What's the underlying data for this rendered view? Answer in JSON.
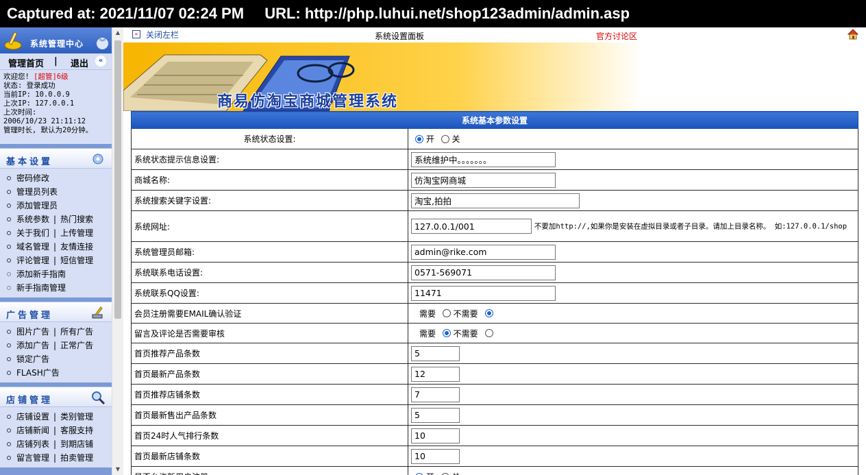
{
  "capture": {
    "captured": "Captured at: 2021/11/07 02:24 PM",
    "url": "URL: http://php.luhui.net/shop123admin/admin.asp"
  },
  "left": {
    "title": "系统管理中心",
    "nav_home": "管理首页",
    "nav_sep": "|",
    "nav_logout": "退出",
    "info": {
      "welcome": "欢迎您!",
      "role": "[超管]6级",
      "status_label": "状态:",
      "status_value": "登录成功",
      "current_ip": "当前IP: 10.0.0.9",
      "last_ip": "上次IP: 127.0.0.1",
      "last_time_label": "上次时间:",
      "last_time": "2006/10/23 21:11:12",
      "session": "管理时长, 默认为20分钟。"
    },
    "sections": [
      {
        "title": "基本设置",
        "rows": [
          {
            "a": "密码修改"
          },
          {
            "a": "管理员列表"
          },
          {
            "a": "添加管理员"
          },
          {
            "a": "系统参数",
            "b": "热门搜索"
          },
          {
            "a": "关于我们",
            "b": "上传管理"
          },
          {
            "a": "域名管理",
            "b": "友情连接"
          },
          {
            "a": "评论管理",
            "b": "短信管理"
          },
          {
            "a": "添加新手指南",
            "dim": true
          },
          {
            "a": "新手指南管理",
            "dim": true
          }
        ]
      },
      {
        "title": "广告管理",
        "rows": [
          {
            "a": "图片广告",
            "b": "所有广告"
          },
          {
            "a": "添加广告",
            "b": "正常广告"
          },
          {
            "a": "锁定广告"
          },
          {
            "a": "FLASH广告"
          }
        ]
      },
      {
        "title": "店铺管理",
        "rows": [
          {
            "a": "店铺设置",
            "b": "类别管理"
          },
          {
            "a": "店铺新闻",
            "b": "客服支持"
          },
          {
            "a": "店铺列表",
            "b": "到期店铺"
          },
          {
            "a": "留言管理",
            "b": "拍卖管理"
          }
        ]
      }
    ]
  },
  "topbar": {
    "close": "关闭左栏",
    "center": "系统设置面板",
    "forum": "官方讨论区"
  },
  "banner": {
    "title": "商易仿淘宝商城管理系统"
  },
  "form": {
    "caption": "系统基本参数设置",
    "status_label": "系统状态设置:",
    "on": "开",
    "off": "关",
    "status_msg_label": "系统状态提示信息设置:",
    "status_msg_value": "系统维护中。。。。。。。",
    "shop_name_label": "商城名称:",
    "shop_name_value": "仿淘宝网商城",
    "keywords_label": "系统搜索关键字设置:",
    "keywords_value": "淘宝,拍拍",
    "url_label": "系统网址:",
    "url_value": "127.0.0.1/001",
    "url_hint": "不要加http://,如果你是安装在虚拟目录或者子目录。请加上目录名称。 如:127.0.0.1/shop",
    "email_label": "系统管理员邮箱:",
    "email_value": "admin@rike.com",
    "phone_label": "系统联系电话设置:",
    "phone_value": "0571-569071",
    "qq_label": "系统联系QQ设置:",
    "qq_value": "11471",
    "reg_email_label": "会员注册需要EMAIL确认验证",
    "need": "需要",
    "no_need": "不需要",
    "review_label": "留言及评论是否需要审核",
    "rec_products_label": "首页推荐产品条数",
    "rec_products_value": "5",
    "new_products_label": "首页最新产品条数",
    "new_products_value": "12",
    "rec_shops_label": "首页推荐店铺条数",
    "rec_shops_value": "7",
    "new_sold_label": "首页最新售出产品条数",
    "new_sold_value": "5",
    "popular_label": "首页24时人气排行条数",
    "popular_value": "10",
    "new_shops_label": "首页最新店铺条数",
    "new_shops_value": "10",
    "next_label": "是否允许新用户注册"
  }
}
